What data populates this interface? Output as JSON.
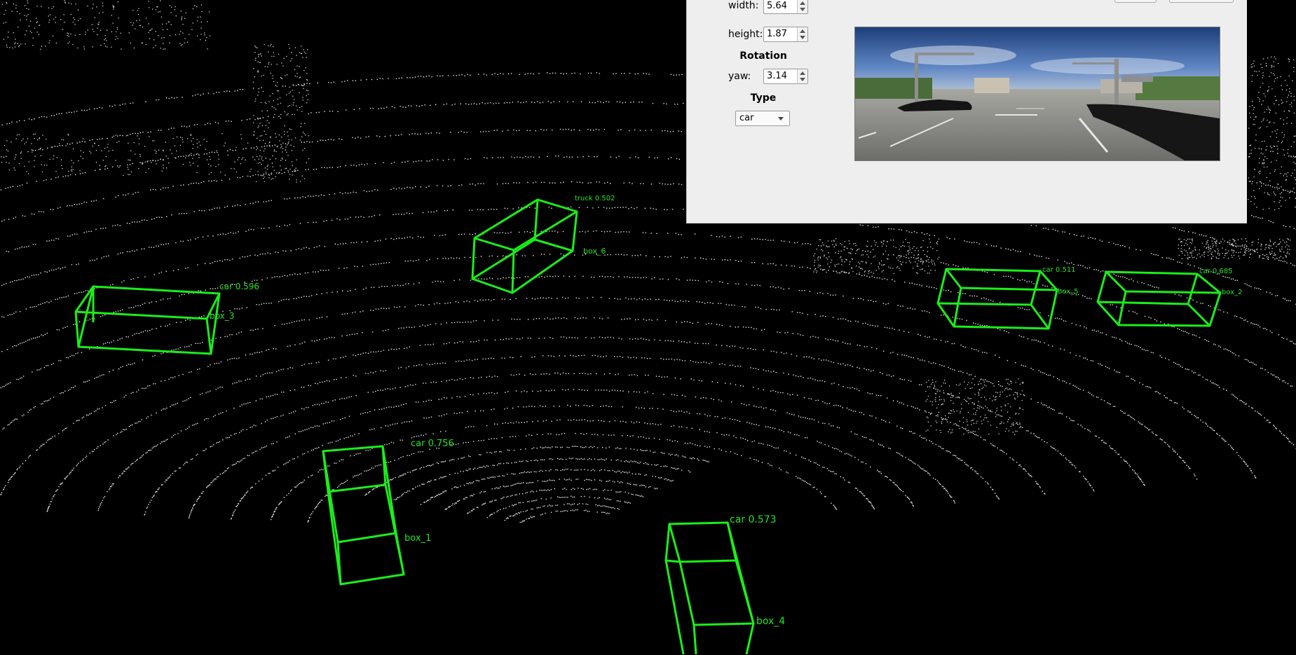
{
  "viewport": {
    "boxes": [
      {
        "id": "box_1",
        "class_label": "car 0.756"
      },
      {
        "id": "box_2",
        "class_label": "car 0.685"
      },
      {
        "id": "box_3",
        "class_label": "car 0.596"
      },
      {
        "id": "box_4",
        "class_label": "car 0.573"
      },
      {
        "id": "box_5",
        "class_label": "car 0.511"
      },
      {
        "id": "box_6",
        "class_label": "truck 0.502"
      }
    ]
  },
  "panel": {
    "dimensions": {
      "width_label": "width:",
      "width_value": "5.64",
      "height_label": "height:",
      "height_value": "1.87"
    },
    "rotation": {
      "title": "Rotation",
      "yaw_label": "yaw:",
      "yaw_value": "3.14"
    },
    "type": {
      "title": "Type",
      "selected": "car"
    }
  },
  "colors": {
    "box": "#1aee1a",
    "panel_bg": "#eeeeee",
    "viewport_bg": "#000000"
  }
}
